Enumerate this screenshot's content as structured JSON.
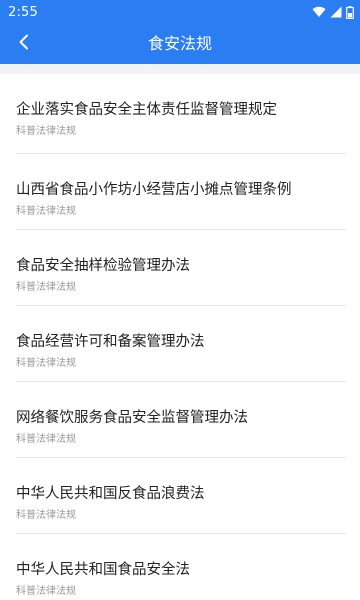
{
  "status_bar": {
    "time": "2:55",
    "icons": [
      "wifi-icon",
      "signal-icon",
      "battery-icon"
    ]
  },
  "app_bar": {
    "title": "食安法规",
    "back_icon": "chevron-left-icon"
  },
  "colors": {
    "primary": "#2b7ef2",
    "title_text": "#222222",
    "sub_text": "#9a9a9a",
    "divider": "#e6e6e6"
  },
  "items": [
    {
      "title": "企业落实食品安全主体责任监督管理规定",
      "category": "科普法律法规"
    },
    {
      "title": "山西省食品小作坊小经营店小摊点管理条例",
      "category": "科普法律法规"
    },
    {
      "title": "食品安全抽样检验管理办法",
      "category": "科普法律法规"
    },
    {
      "title": "食品经营许可和备案管理办法",
      "category": "科普法律法规"
    },
    {
      "title": "网络餐饮服务食品安全监督管理办法",
      "category": "科普法律法规"
    },
    {
      "title": "中华人民共和国反食品浪费法",
      "category": "科普法律法规"
    },
    {
      "title": "中华人民共和国食品安全法",
      "category": "科普法律法规"
    }
  ]
}
